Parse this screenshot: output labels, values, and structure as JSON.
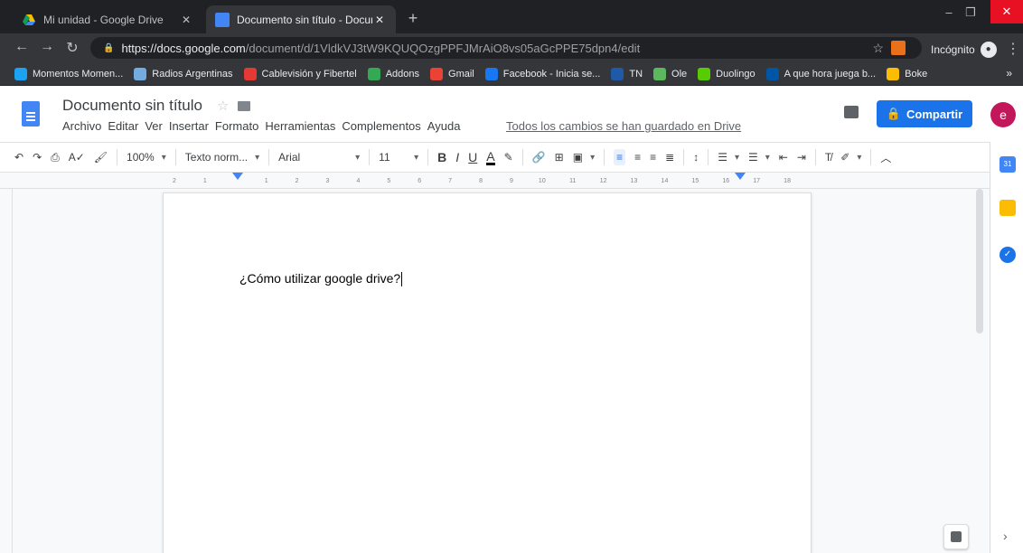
{
  "browser": {
    "tabs": [
      {
        "title": "Mi unidad - Google Drive",
        "active": false
      },
      {
        "title": "Documento sin título - Documen",
        "active": true
      }
    ],
    "new_tab": "+",
    "url_domain": "https://docs.google.com",
    "url_path": "/document/d/1VldkVJ3tW9KQUQOzgPPFJMrAiO8vs05aGcPPE75dpn4/edit",
    "incognito_label": "Incógnito",
    "bookmarks": [
      {
        "label": "Momentos Momen...",
        "color": "#1da1f2"
      },
      {
        "label": "Radios Argentinas",
        "color": "#74acdf"
      },
      {
        "label": "Cablevisión y Fibertel",
        "color": "#e53935"
      },
      {
        "label": "Addons",
        "color": "#34a853"
      },
      {
        "label": "Gmail",
        "color": "#ea4335"
      },
      {
        "label": "Facebook - Inicia se...",
        "color": "#1877f2"
      },
      {
        "label": "TN",
        "color": "#1e5aa8"
      },
      {
        "label": "Ole",
        "color": "#5cb85c"
      },
      {
        "label": "Duolingo",
        "color": "#58cc02"
      },
      {
        "label": "A que hora juega b...",
        "color": "#0055a4"
      },
      {
        "label": "Boke",
        "color": "#fbbc04"
      }
    ],
    "bookmarks_more": "»"
  },
  "docs": {
    "title": "Documento sin título",
    "menu": [
      "Archivo",
      "Editar",
      "Ver",
      "Insertar",
      "Formato",
      "Herramientas",
      "Complementos",
      "Ayuda"
    ],
    "save_status": "Todos los cambios se han guardado en Drive",
    "share_label": "Compartir",
    "avatar_initial": "e",
    "toolbar": {
      "zoom": "100%",
      "style": "Texto norm...",
      "font": "Arial",
      "size": "11"
    },
    "ruler_marks": [
      "2",
      "1",
      "",
      "1",
      "2",
      "3",
      "4",
      "5",
      "6",
      "7",
      "8",
      "9",
      "10",
      "11",
      "12",
      "13",
      "14",
      "15",
      "16",
      "17",
      "18"
    ],
    "body_text": "¿Cómo utilizar google drive?"
  },
  "side_panel": {
    "calendar_label": "31"
  },
  "colors": {
    "accent": "#1a73e8",
    "docs_blue": "#4285f4",
    "avatar": "#c2185b"
  }
}
